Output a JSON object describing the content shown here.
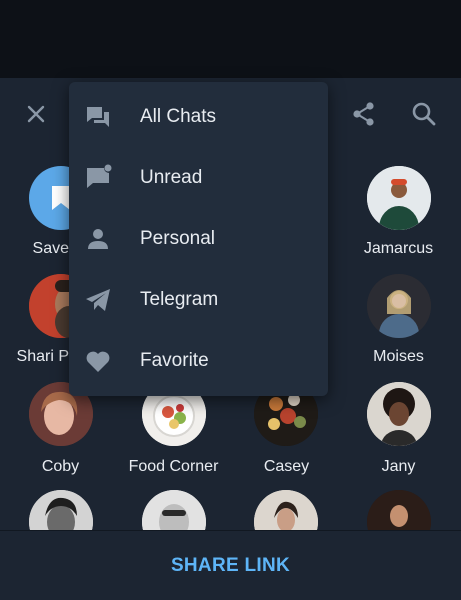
{
  "colors": {
    "accent": "#5eb5f7",
    "sheet": "#1c2532",
    "menu": "#222d3c",
    "icon": "#8a97a6"
  },
  "header": {
    "close_icon": "close-icon",
    "share_icon": "share-icon",
    "search_icon": "search-icon"
  },
  "folder_menu": {
    "items": [
      {
        "label": "All Chats",
        "icon": "chats-icon"
      },
      {
        "label": "Unread",
        "icon": "unread-icon"
      },
      {
        "label": "Personal",
        "icon": "person-icon"
      },
      {
        "label": "Telegram",
        "icon": "telegram-icon"
      },
      {
        "label": "Favorite",
        "icon": "heart-icon"
      }
    ]
  },
  "contacts": [
    {
      "name": "Saved Messages",
      "visible_name": "Save"
    },
    {
      "name": "Jamarcus"
    },
    {
      "name": "Shari P",
      "visible_name": "Shari P"
    },
    {
      "name": "Moises"
    },
    {
      "name": "Coby"
    },
    {
      "name": "Food Corner"
    },
    {
      "name": "Casey"
    },
    {
      "name": "Jany"
    }
  ],
  "footer": {
    "share_label": "SHARE LINK"
  }
}
